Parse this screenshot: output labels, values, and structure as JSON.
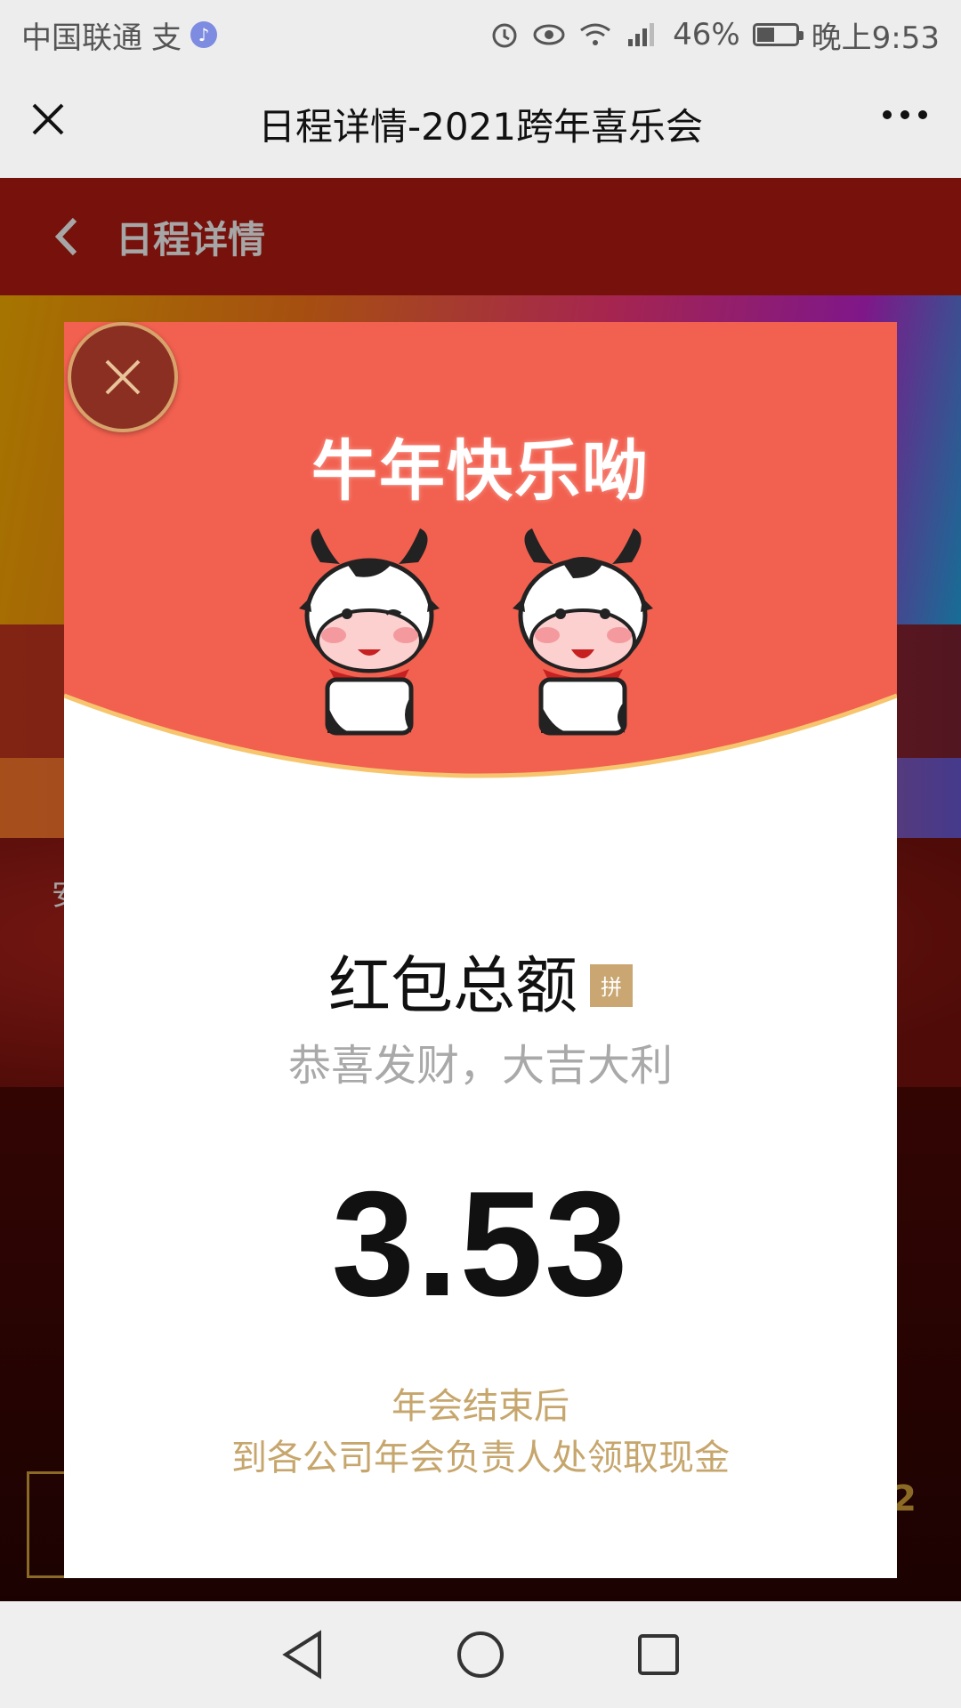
{
  "status_bar": {
    "carrier": "中国联通",
    "carrier_extra": "支",
    "music_icon": "music-note-icon",
    "battery_percent": "46%",
    "battery_level": 0.46,
    "time": "晚上9:53"
  },
  "title_bar": {
    "title": "日程详情-2021跨年喜乐会"
  },
  "page": {
    "header_title": "日程详情",
    "peek_text": "安",
    "peek_number": "2"
  },
  "packet": {
    "banner_title": "牛年快乐呦",
    "heading": "红包总额",
    "badge": "拼",
    "greeting": "恭喜发财，大吉大利",
    "amount": "3.53",
    "note_line1": "年会结束后",
    "note_line2": "到各公司年会负责人处领取现金"
  },
  "colors": {
    "packet_red": "#f2604f",
    "header_red": "#b51b12",
    "gold": "#c6a66c"
  }
}
